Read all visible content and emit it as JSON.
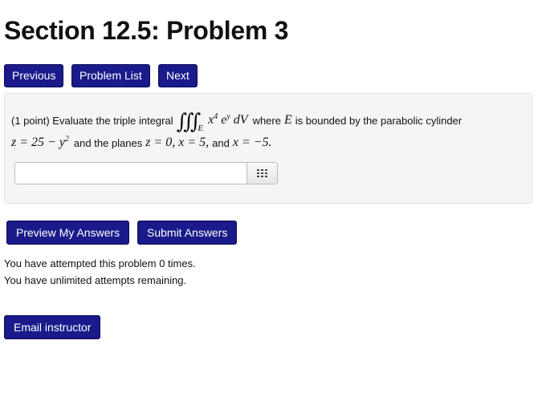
{
  "page": {
    "title": "Section 12.5: Problem 3"
  },
  "nav": {
    "previous_label": "Previous",
    "problem_list_label": "Problem List",
    "next_label": "Next"
  },
  "problem": {
    "points_prefix": "(1 point) Evaluate the triple integral",
    "integral_sign": "∭",
    "integral_region": "E",
    "integrand_base": "x",
    "integrand_exp": "4",
    "integrand_e": "e",
    "integrand_e_exp": "y",
    "integrand_dv": "dV",
    "where_text": "where",
    "region_symbol": "E",
    "bounded_text": "is bounded by the parabolic cylinder",
    "surface_lhs": "z = 25 − y",
    "surface_exp": "2",
    "planes_text": "and the planes",
    "planes_math": "z = 0, x = 5,",
    "and_text": "and",
    "last_plane": "x = −5."
  },
  "answer": {
    "value": "",
    "palette_icon": "grid-icon"
  },
  "actions": {
    "preview_label": "Preview My Answers",
    "submit_label": "Submit Answers",
    "email_label": "Email instructor"
  },
  "status": {
    "attempts_line": "You have attempted this problem 0 times.",
    "remaining_line": "You have unlimited attempts remaining."
  },
  "colors": {
    "button_bg": "#1a1a8a",
    "box_bg": "#f5f5f5"
  }
}
